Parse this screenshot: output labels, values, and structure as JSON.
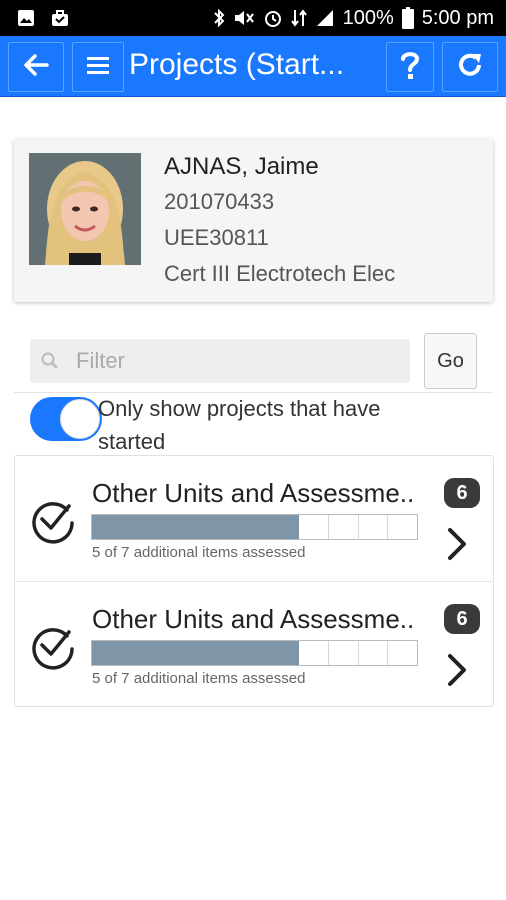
{
  "status_bar": {
    "battery": "100%",
    "time": "5:00 pm",
    "icons": [
      "image-icon",
      "briefcase-icon",
      "bluetooth-icon",
      "mute-icon",
      "alarm-icon",
      "data-icon",
      "signal-icon",
      "battery-icon"
    ]
  },
  "app_bar": {
    "title": "Projects (Start...",
    "back_icon": "arrow-left-icon",
    "menu_icon": "hamburger-menu-icon",
    "help_icon": "question-mark-icon",
    "refresh_icon": "refresh-icon",
    "color": "#1a78ff"
  },
  "profile": {
    "name": "AJNAS, Jaime",
    "student_id": "201070433",
    "course_code": "UEE30811",
    "course_name": "Cert III Electrotech Elec"
  },
  "filter": {
    "placeholder": "Filter",
    "value": "",
    "go_label": "Go"
  },
  "toggle": {
    "label": "Only show projects that have started",
    "on": true
  },
  "projects": [
    {
      "title": "Other Units and Assessme..",
      "progress_text": "5 of 7 additional items assessed",
      "assessed": 5,
      "total": 7,
      "badge": "6"
    },
    {
      "title": "Other Units and Assessme..",
      "progress_text": "5 of 7 additional items assessed",
      "assessed": 5,
      "total": 7,
      "badge": "6"
    }
  ]
}
